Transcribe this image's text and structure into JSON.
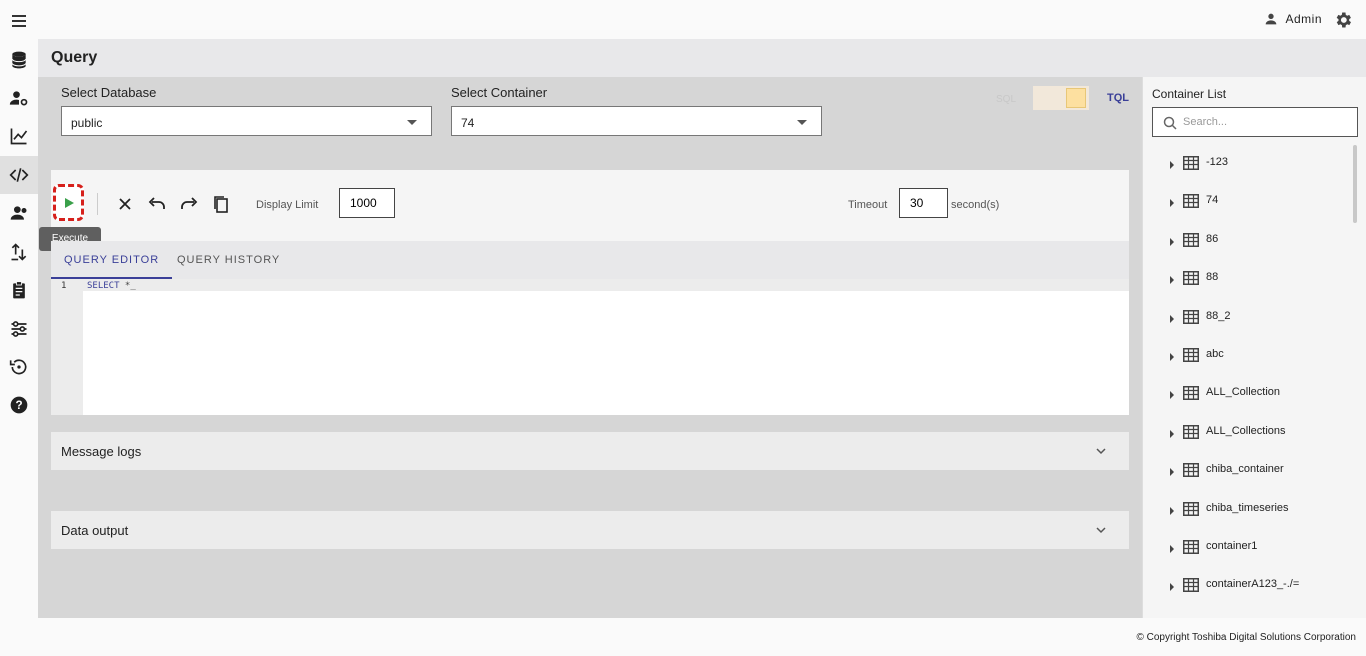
{
  "header": {
    "user_name": "Admin",
    "page_title": "Query"
  },
  "database": {
    "label": "Select Database",
    "value": "public"
  },
  "container": {
    "label": "Select Container",
    "value": "74"
  },
  "mode_toggle": {
    "off_label": "SQL",
    "on_label": "TQL"
  },
  "toolbar": {
    "execute_tooltip": "Execute",
    "display_limit_label": "Display Limit",
    "display_limit_value": "1000",
    "timeout_label": "Timeout",
    "timeout_value": "30",
    "timeout_unit": "second(s)"
  },
  "tabs": [
    {
      "label": "QUERY EDITOR",
      "active": true
    },
    {
      "label": "QUERY HISTORY",
      "active": false
    }
  ],
  "editor": {
    "line_number": "1",
    "keyword": "SELECT",
    "rest": " *_"
  },
  "panels": {
    "message_logs": "Message logs",
    "data_output": "Data output"
  },
  "container_list": {
    "title": "Container List",
    "search_placeholder": "Search...",
    "items": [
      "-123",
      "74",
      "86",
      "88",
      "88_2",
      "abc",
      "ALL_Collection",
      "ALL_Collections",
      "chiba_container",
      "chiba_timeseries",
      "container1",
      "containerA123_-./="
    ]
  },
  "footer": {
    "copyright": "© Copyright Toshiba Digital Solutions Corporation"
  },
  "colors": {
    "accent": "#3a3f98",
    "execute_highlight": "#d6201b",
    "play_green": "#3aa04a"
  }
}
